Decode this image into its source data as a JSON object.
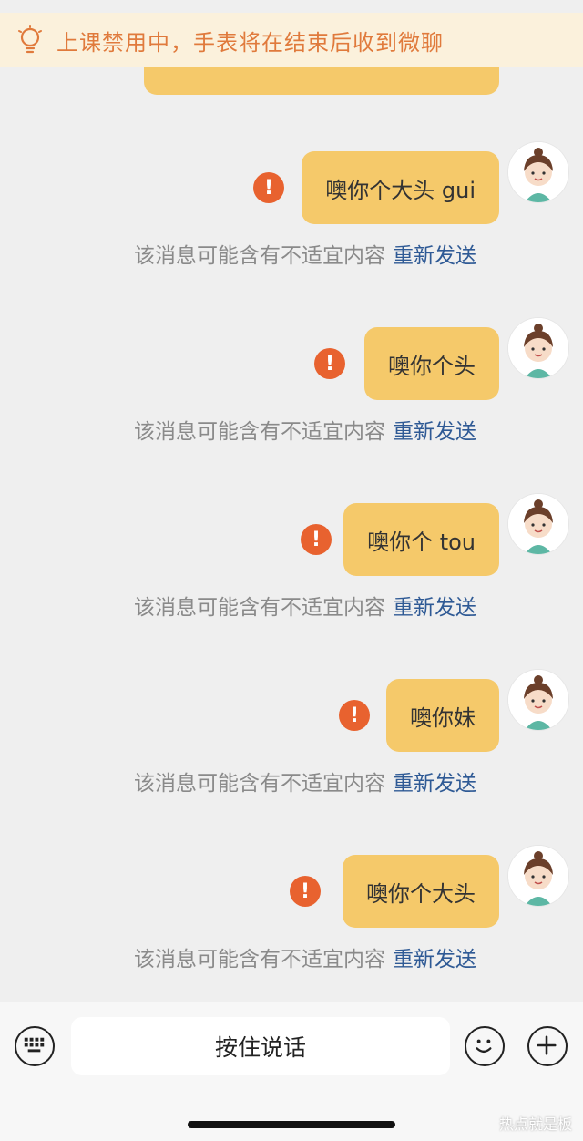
{
  "banner": {
    "icon": "lightbulb-icon",
    "text": "上课禁用中，手表将在结束后收到微聊"
  },
  "messages": [
    {
      "text": "噢你个大头 gui",
      "warning_icon": "warning-icon",
      "notice": "该消息可能含有不适宜内容",
      "resend": "重新发送"
    },
    {
      "text": "噢你个头",
      "warning_icon": "warning-icon",
      "notice": "该消息可能含有不适宜内容",
      "resend": "重新发送"
    },
    {
      "text": "噢你个 tou",
      "warning_icon": "warning-icon",
      "notice": "该消息可能含有不适宜内容",
      "resend": "重新发送"
    },
    {
      "text": "噢你妹",
      "warning_icon": "warning-icon",
      "notice": "该消息可能含有不适宜内容",
      "resend": "重新发送"
    },
    {
      "text": "噢你个大头",
      "warning_icon": "warning-icon",
      "notice": "该消息可能含有不适宜内容",
      "resend": "重新发送"
    }
  ],
  "input": {
    "voice_label": "按住说话"
  },
  "watermark": "热点就是板",
  "colors": {
    "bubble": "#f5c96a",
    "warning": "#e8622f",
    "resend": "#2f5a95",
    "banner_text": "#e07a3c"
  }
}
